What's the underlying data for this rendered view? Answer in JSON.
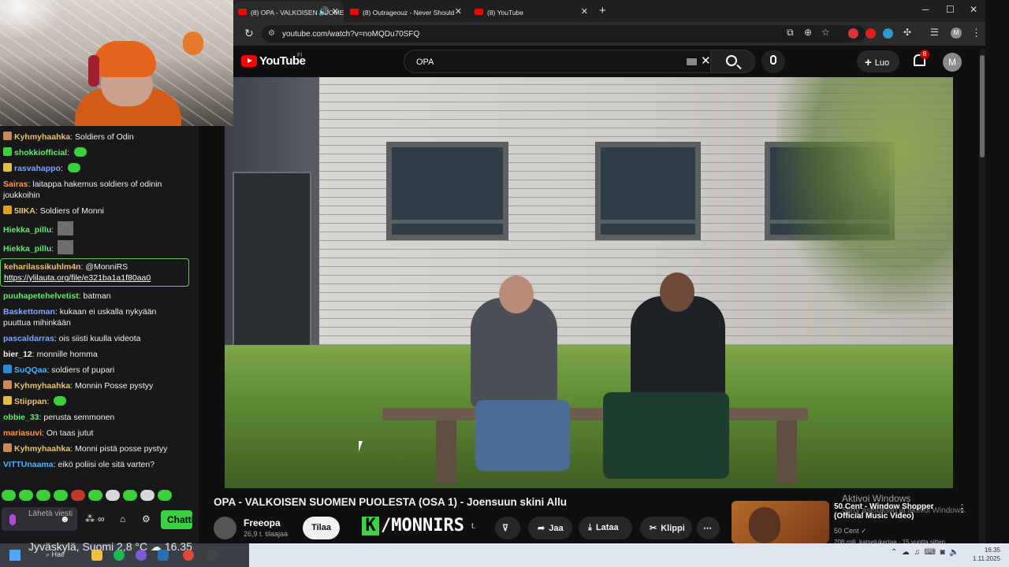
{
  "stream": {
    "chat": [
      {
        "user": "Kyhmyhaahka",
        "color": "#e6c46a",
        "text": "Soldiers of Odin",
        "badge": "#c58b5a"
      },
      {
        "user": "shokkiofficial",
        "color": "#63e86b",
        "text": "",
        "badge": "#3ccf3c",
        "emote": true
      },
      {
        "user": "rasvahappo",
        "color": "#7aa6ff",
        "text": "",
        "badge": "#e0c040",
        "emote": true
      },
      {
        "user": "Sairas",
        "color": "#ff9a3c",
        "text": "laitappa hakemus soldiers of odinin joukkoihin"
      },
      {
        "user": "5IIKA",
        "color": "#e6c46a",
        "text": "Soldiers of Monni",
        "badge": "#e0a020"
      },
      {
        "user": "Hiekka_pillu",
        "color": "#63e86b",
        "text": "",
        "thumb": true
      },
      {
        "user": "Hiekka_pillu",
        "color": "#63e86b",
        "text": "",
        "thumb": true
      },
      {
        "user": "keharilassikuhlm4n",
        "color": "#e6c46a",
        "text": "@MonniRS",
        "link": "https://ylilauta.org/file/e321ba1a1f80aa0",
        "highlight": true
      },
      {
        "user": "puuhapetehelvetist",
        "color": "#63e86b",
        "text": "batman"
      },
      {
        "user": "Baskettoman",
        "color": "#7aa6ff",
        "text": "kukaan ei uskalla nykyään puuttua mihinkään"
      },
      {
        "user": "pascaldarras",
        "color": "#7aa6ff",
        "text": "ois siisti kuulla videota"
      },
      {
        "user": "bier_12",
        "color": "#efeff1",
        "text": "monnille homma"
      },
      {
        "user": "SuQQaa",
        "color": "#46b4ff",
        "text": "soldiers of pupari",
        "badge": "#2a8ad4"
      },
      {
        "user": "Kyhmyhaahka",
        "color": "#e6c46a",
        "text": "Monnin Posse pystyy",
        "badge": "#c58b5a"
      },
      {
        "user": "Stiippan",
        "color": "#e6c46a",
        "text": "",
        "badge": "#e0c040",
        "emote": true
      },
      {
        "user": "obbie_33",
        "color": "#63e86b",
        "text": "perusta semmonen"
      },
      {
        "user": "mariasuvi",
        "color": "#ff9a3c",
        "text": "On taas jutut"
      },
      {
        "user": "Kyhmyhaahka",
        "color": "#e6c46a",
        "text": "Monni pistä posse pystyy",
        "badge": "#c58b5a"
      },
      {
        "user": "VITTUnaama",
        "color": "#46b4ff",
        "text": "eikö poliisi ole sitä varten?"
      }
    ],
    "input_placeholder": "Lähetä viesti",
    "send_label": "Chatti"
  },
  "browser": {
    "tabs": [
      {
        "label": "(8) OPA - VALKOISEN SUOMEN",
        "active": true
      },
      {
        "label": "(8) Outrageouz - Never Should",
        "active": false
      },
      {
        "label": "(8) YouTube",
        "active": false
      }
    ],
    "url": "youtube.com/watch?v=noMQDu70SFQ"
  },
  "youtube": {
    "logo_text": "YouTube",
    "region": "FI",
    "search_value": "OPA",
    "create_label": "Luo",
    "notifications": "8",
    "avatar_letter": "M",
    "video_title": "OPA - VALKOISEN SUOMEN PUOLESTA (OSA 1) - Joensuun skini Allu",
    "channel": "Freeopa",
    "subscribers": "26,9 t. tilaajaa",
    "subscribe_label": "Tilaa",
    "overlay_logo": "/MONNIRS",
    "likes_fragment": "t.",
    "share_label": "Jaa",
    "download_label": "Lataa",
    "clip_label": "Klippi",
    "recommended": {
      "title": "50 Cent - Window Shopper (Official Music Video)",
      "channel": "50 Cent",
      "views": "208 milj. katselukertaa · 15 vuotta sitten"
    }
  },
  "windows": {
    "activate_title": "Aktivoi Windows",
    "activate_sub": "Siirry asetuksiin ja aktivoi Windows.",
    "weather": "Jyväskylä, Suomi   2,8 °C",
    "weather_time": "16.35",
    "search_label": "Hae",
    "time": "16.35",
    "date": "1.11.2025"
  }
}
